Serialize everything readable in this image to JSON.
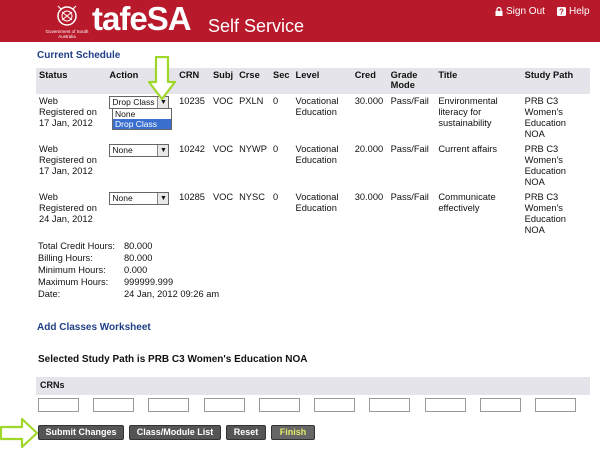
{
  "header": {
    "crest_text": "Government of South Australia",
    "logo_tafe": "tafe",
    "logo_sa": "SA",
    "subtitle": "Self Service",
    "signout_label": "Sign Out",
    "help_label": "Help",
    "bg_color": "#b8192b"
  },
  "current_schedule": {
    "title": "Current Schedule",
    "columns": [
      "Status",
      "Action",
      "CRN",
      "Subj",
      "Crse",
      "Sec",
      "Level",
      "Cred",
      "Grade Mode",
      "Title",
      "Study Path"
    ],
    "rows": [
      {
        "status": "Web Registered on 17 Jan, 2012",
        "action": "Drop Class",
        "crn": "10235",
        "subj": "VOC",
        "crse": "PXLN",
        "sec": "0",
        "level": "Vocational Education",
        "cred": "30.000",
        "grade_mode": "Pass/Fail",
        "title": "Environmental literacy for sustainability",
        "study_path": "PRB C3 Women's Education NOA"
      },
      {
        "status": "Web Registered on 17 Jan, 2012",
        "action": "None",
        "crn": "10242",
        "subj": "VOC",
        "crse": "NYWP",
        "sec": "0",
        "level": "Vocational Education",
        "cred": "20.000",
        "grade_mode": "Pass/Fail",
        "title": "Current affairs",
        "study_path": "PRB C3 Women's Education NOA"
      },
      {
        "status": "Web Registered on 24 Jan, 2012",
        "action": "None",
        "crn": "10285",
        "subj": "VOC",
        "crse": "NYSC",
        "sec": "0",
        "level": "Vocational Education",
        "cred": "30.000",
        "grade_mode": "Pass/Fail",
        "title": "Communicate effectively",
        "study_path": "PRB C3 Women's Education NOA"
      }
    ],
    "dropdown_options": [
      "None",
      "Drop Class"
    ],
    "dropdown_highlighted": "Drop Class"
  },
  "summary": [
    {
      "key": "Total Credit Hours:",
      "value": "80.000"
    },
    {
      "key": "Billing Hours:",
      "value": "80.000"
    },
    {
      "key": "Minimum Hours:",
      "value": "0.000"
    },
    {
      "key": "Maximum Hours:",
      "value": "999999.999"
    },
    {
      "key": "Date:",
      "value": "24 Jan, 2012 09:26 am"
    }
  ],
  "worksheet": {
    "title": "Add Classes Worksheet",
    "path_line": "Selected Study Path is PRB C3 Women's Education NOA",
    "crn_label": "CRNs"
  },
  "buttons": {
    "submit": "Submit Changes",
    "class_list": "Class/Module List",
    "reset": "Reset",
    "finish": "Finish"
  },
  "colors": {
    "annotation_arrow": "#9ed62a",
    "link_blue": "#1f3f86"
  }
}
